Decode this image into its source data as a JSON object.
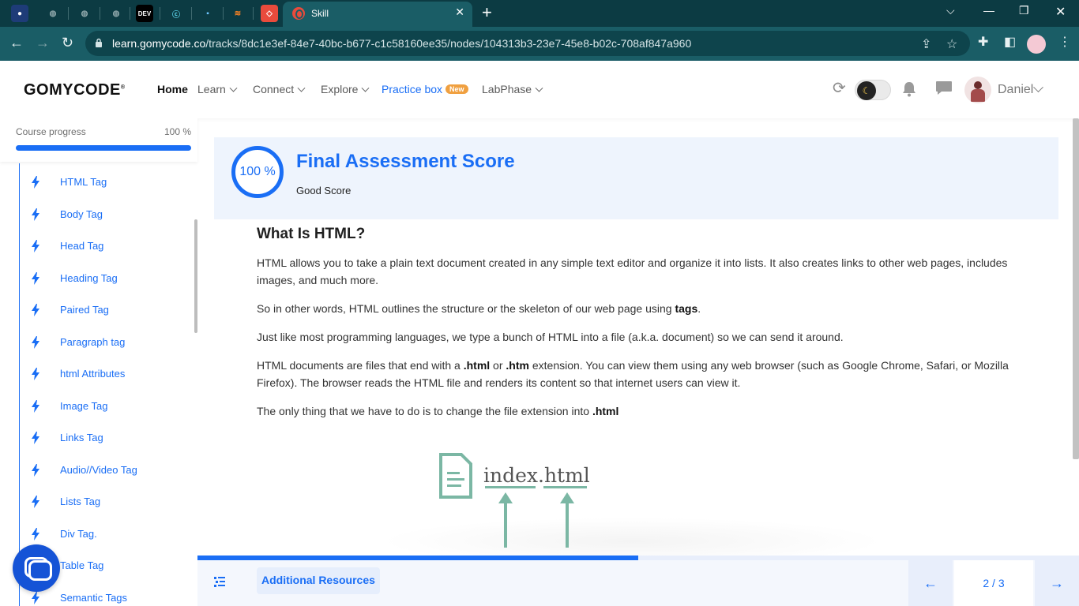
{
  "browser": {
    "active_tab_title": "Skill",
    "pinned_tabs": [
      "DEV"
    ],
    "url_host": "learn.gomycode.co",
    "url_path": "/tracks/8dc1e3ef-84e7-40bc-b677-c1c58160ee35/nodes/104313b3-23e7-45e8-b02c-708af847a960"
  },
  "header": {
    "logo": "GOMYCODE",
    "nav": [
      {
        "label": "Home"
      },
      {
        "label": "Learn"
      },
      {
        "label": "Connect"
      },
      {
        "label": "Explore"
      },
      {
        "label": "Practice box",
        "badge": "New"
      },
      {
        "label": "LabPhase"
      }
    ],
    "user_name": "Daniel"
  },
  "sidebar": {
    "progress_label": "Course progress",
    "progress_value": "100 %",
    "progress_fraction": 1.0,
    "lessons": [
      {
        "label": "HTML Tag"
      },
      {
        "label": "Body Tag"
      },
      {
        "label": "Head Tag"
      },
      {
        "label": "Heading Tag"
      },
      {
        "label": "Paired Tag"
      },
      {
        "label": "Paragraph tag"
      },
      {
        "label": "html Attributes"
      },
      {
        "label": "Image Tag"
      },
      {
        "label": "Links Tag"
      },
      {
        "label": "Audio//Video Tag"
      },
      {
        "label": "Lists Tag"
      },
      {
        "label": "Div Tag."
      },
      {
        "label": "Table Tag"
      },
      {
        "label": "Semantic Tags"
      }
    ]
  },
  "score": {
    "value": "100 %",
    "title": "Final Assessment Score",
    "subtitle": "Good Score"
  },
  "article": {
    "heading": "What Is HTML?",
    "p1": "HTML allows you to take a plain text document created in any simple text editor and organize it into lists. It also creates links to other web pages, includes images, and much more.",
    "p2_pre": "So in other words, HTML outlines the structure or the skeleton of our web page using ",
    "p2_bold": "tags",
    "p2_post": ".",
    "p3": "Just like most programming languages, we type a bunch of HTML into a file (a.k.a. document) so we can send it around.",
    "p4_a": "HTML documents are files that end with a ",
    "p4_b": ".html",
    "p4_c": " or ",
    "p4_d": ".htm",
    "p4_e": " extension. You can view them using any web browser (such as Google Chrome, Safari, or Mozilla Firefox). The browser reads the HTML file and renders its content so that internet users can view it.",
    "p5_pre": "The only thing that we have to do is to change the file extension into ",
    "p5_bold": ".html",
    "illustration_name": "index",
    "illustration_dot": ".",
    "illustration_ext": "html"
  },
  "footer": {
    "content_progress_fraction": 0.5,
    "resources_label": "Additional Resources",
    "pager": "2 / 3"
  },
  "colors": {
    "accent": "#1a6ef5",
    "chrome_dark": "#0c3b43",
    "chrome": "#1a5d66",
    "illustration": "#7bb7a4",
    "badge": "#f0a040"
  }
}
